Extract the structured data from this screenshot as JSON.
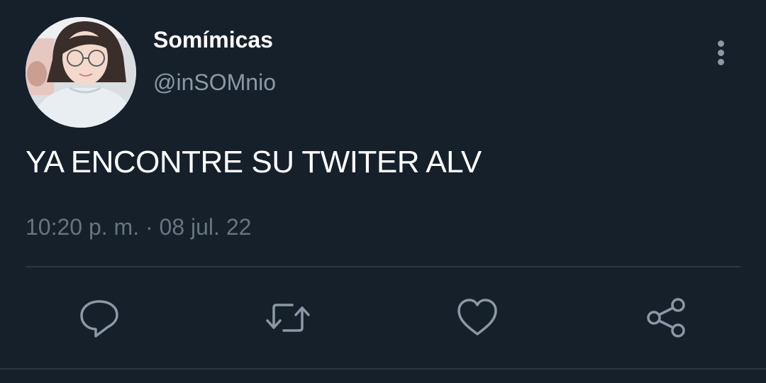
{
  "author": {
    "display_name": "Somímicas",
    "handle": "@inSOMnio"
  },
  "tweet": {
    "text": "YA ENCONTRE SU TWITER ALV",
    "timestamp": "10:20 p. m. · 08 jul. 22"
  },
  "actions": {
    "reply_icon": "speech-bubble-icon",
    "retweet_icon": "retweet-arrows-icon",
    "like_icon": "heart-icon",
    "share_icon": "share-nodes-icon"
  },
  "more_menu_icon": "vertical-ellipsis-icon",
  "colors": {
    "background": "#15202b",
    "primary_text": "#ffffff",
    "secondary_text": "#8b98a5",
    "muted_text": "#66757f",
    "divider": "#2a3642"
  }
}
